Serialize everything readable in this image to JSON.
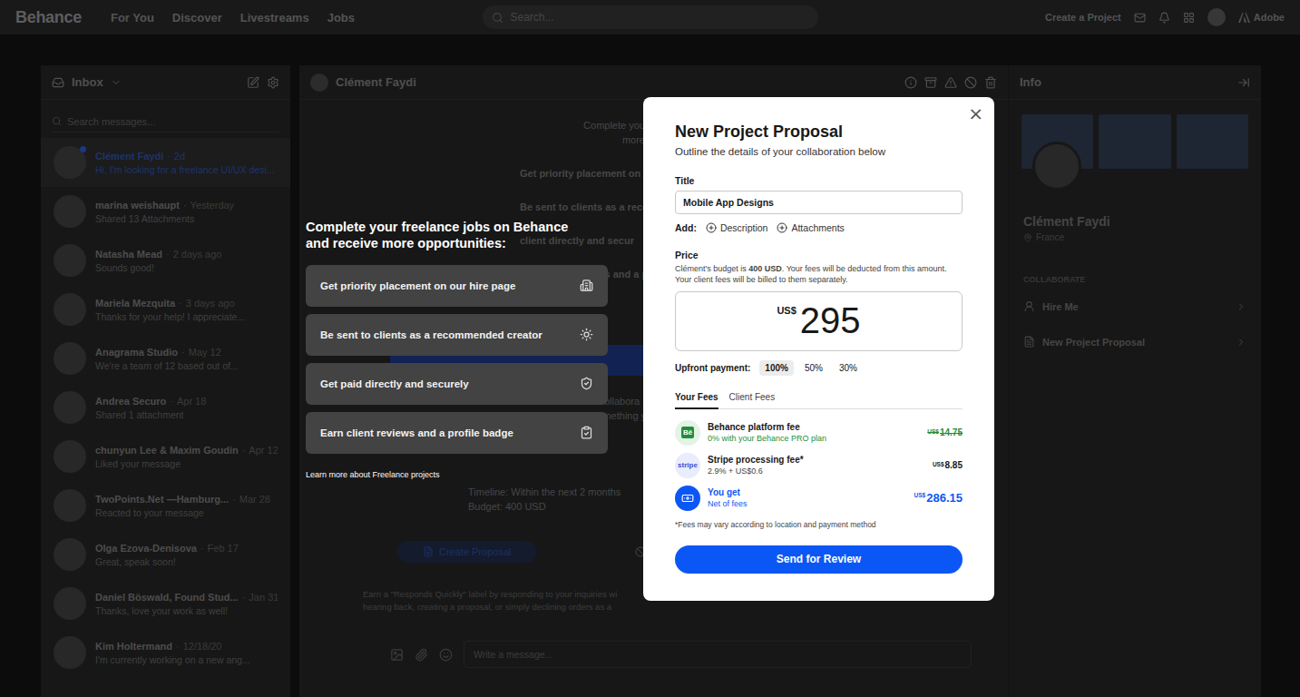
{
  "nav": {
    "logo": "Behance",
    "links": [
      "For You",
      "Discover",
      "Livestreams",
      "Jobs"
    ],
    "search_placeholder": "Search...",
    "create": "Create a Project",
    "adobe": "Adobe"
  },
  "inbox": {
    "title": "Inbox",
    "search_placeholder": "Search messages...",
    "separator": "·",
    "conversations": [
      {
        "name": "Clément Faydi",
        "time": "2d",
        "preview": "Hi, I'm looking for a freelance UI/UX desi...",
        "unread": true,
        "selected": true
      },
      {
        "name": "marina weishaupt",
        "time": "Yesterday",
        "preview": "Shared 13 Attachments",
        "unread": false,
        "selected": false
      },
      {
        "name": "Natasha Mead",
        "time": "2 days ago",
        "preview": "Sounds good!",
        "unread": false,
        "selected": false
      },
      {
        "name": "Mariela Mezquita",
        "time": "3 days ago",
        "preview": "Thanks for your help! I appreciate...",
        "unread": false,
        "selected": false
      },
      {
        "name": "Anagrama Studio",
        "time": "May 12",
        "preview": "We're a team of 12 based out of...",
        "unread": false,
        "selected": false
      },
      {
        "name": "Andrea Securo",
        "time": "Apr 18",
        "preview": "Shared 1 attachment",
        "unread": false,
        "selected": false
      },
      {
        "name": "chunyun Lee & Maxim Goudin",
        "time": "Apr 12",
        "preview": "Liked your message",
        "unread": false,
        "selected": false
      },
      {
        "name": "TwoPoints.Net —Hamburg...",
        "time": "Mar 28",
        "preview": "Reacted to your message",
        "unread": false,
        "selected": false
      },
      {
        "name": "Olga Ezova-Denisova",
        "time": "Feb 17",
        "preview": "Great, speak soon!",
        "unread": false,
        "selected": false
      },
      {
        "name": "Daniel Böswald, Found Stud...",
        "time": "Jan 31",
        "preview": "Thanks, love your work as well!",
        "unread": false,
        "selected": false
      },
      {
        "name": "Kim Holtermand",
        "time": "12/18/20",
        "preview": "I'm currently working on a new ang...",
        "unread": false,
        "selected": false
      }
    ]
  },
  "chat": {
    "contact": "Clément Faydi",
    "intro_lines": [
      "Complete your freelance",
      "more o"
    ],
    "intro_items": [
      "Get priority placement on o",
      "Be sent to clients as a reco",
      "client directly and secur",
      "Earn client reviews and a p"
    ],
    "message_lines": [
      "ollabora",
      "me on a mobile project I'm working on. Is this something y"
    ],
    "meta_lines": [
      "Timeline: Within the next 2 months",
      "Budget: 400 USD"
    ],
    "create_proposal": "Create Proposal",
    "decline": "Decline",
    "footer_lines": [
      "Earn a \"Responds Quickly\" label by responding to your inquiries wi",
      "hearing back, creating a proposal, or simply declining orders as a"
    ],
    "composer_placeholder": "Write a message..."
  },
  "info": {
    "title": "Info",
    "name": "Clément Faydi",
    "location": "France",
    "section": "COLLABORATE",
    "actions": [
      "Hire Me",
      "New Project Proposal"
    ]
  },
  "promo": {
    "title": "Complete your freelance jobs on Behance and receive more opportunities:",
    "items": [
      "Get priority placement on our hire page",
      "Be sent to clients as a recommended creator",
      "Get paid directly and securely",
      "Earn client reviews and a profile badge"
    ],
    "link": "Learn more about Freelance projects"
  },
  "modal": {
    "close": "×",
    "title": "New Project Proposal",
    "subtitle": "Outline the details of your collaboration below",
    "title_label": "Title",
    "title_value": "Mobile App Designs",
    "add_label": "Add:",
    "add_options": [
      "Description",
      "Attachments"
    ],
    "price_label": "Price",
    "budget_note": [
      {
        "text": "Clément's budget is ",
        "bold": false
      },
      {
        "text": "400 USD",
        "bold": true
      },
      {
        "text": ". Your fees will be deducted from this amount. Your client fees will be billed to them separately.",
        "bold": false
      }
    ],
    "price_currency": "US$",
    "price_value": "295",
    "upfront_label": "Upfront payment:",
    "upfront_options": [
      {
        "label": "100%",
        "selected": true
      },
      {
        "label": "50%",
        "selected": false
      },
      {
        "label": "30%",
        "selected": false
      }
    ],
    "fee_tabs": [
      {
        "label": "Your Fees",
        "selected": true
      },
      {
        "label": "Client Fees",
        "selected": false
      }
    ],
    "fees": [
      {
        "kind": "platform",
        "badge": "Bē",
        "name": "Behance platform fee",
        "note": "0% with your Behance PRO plan",
        "currency": "US$",
        "amount": "14.75",
        "struck": true
      },
      {
        "kind": "processing",
        "badge": "stripe",
        "name": "Stripe processing fee*",
        "note": "2.9% + US$0.6",
        "currency": "US$",
        "amount": "8.85",
        "struck": false
      },
      {
        "kind": "total",
        "badge": "",
        "name": "You get",
        "note": "Net of fees",
        "currency": "US$",
        "amount": "286.15",
        "struck": false
      }
    ],
    "footnote": "*Fees may vary according to location and payment method",
    "submit": "Send for Review"
  }
}
